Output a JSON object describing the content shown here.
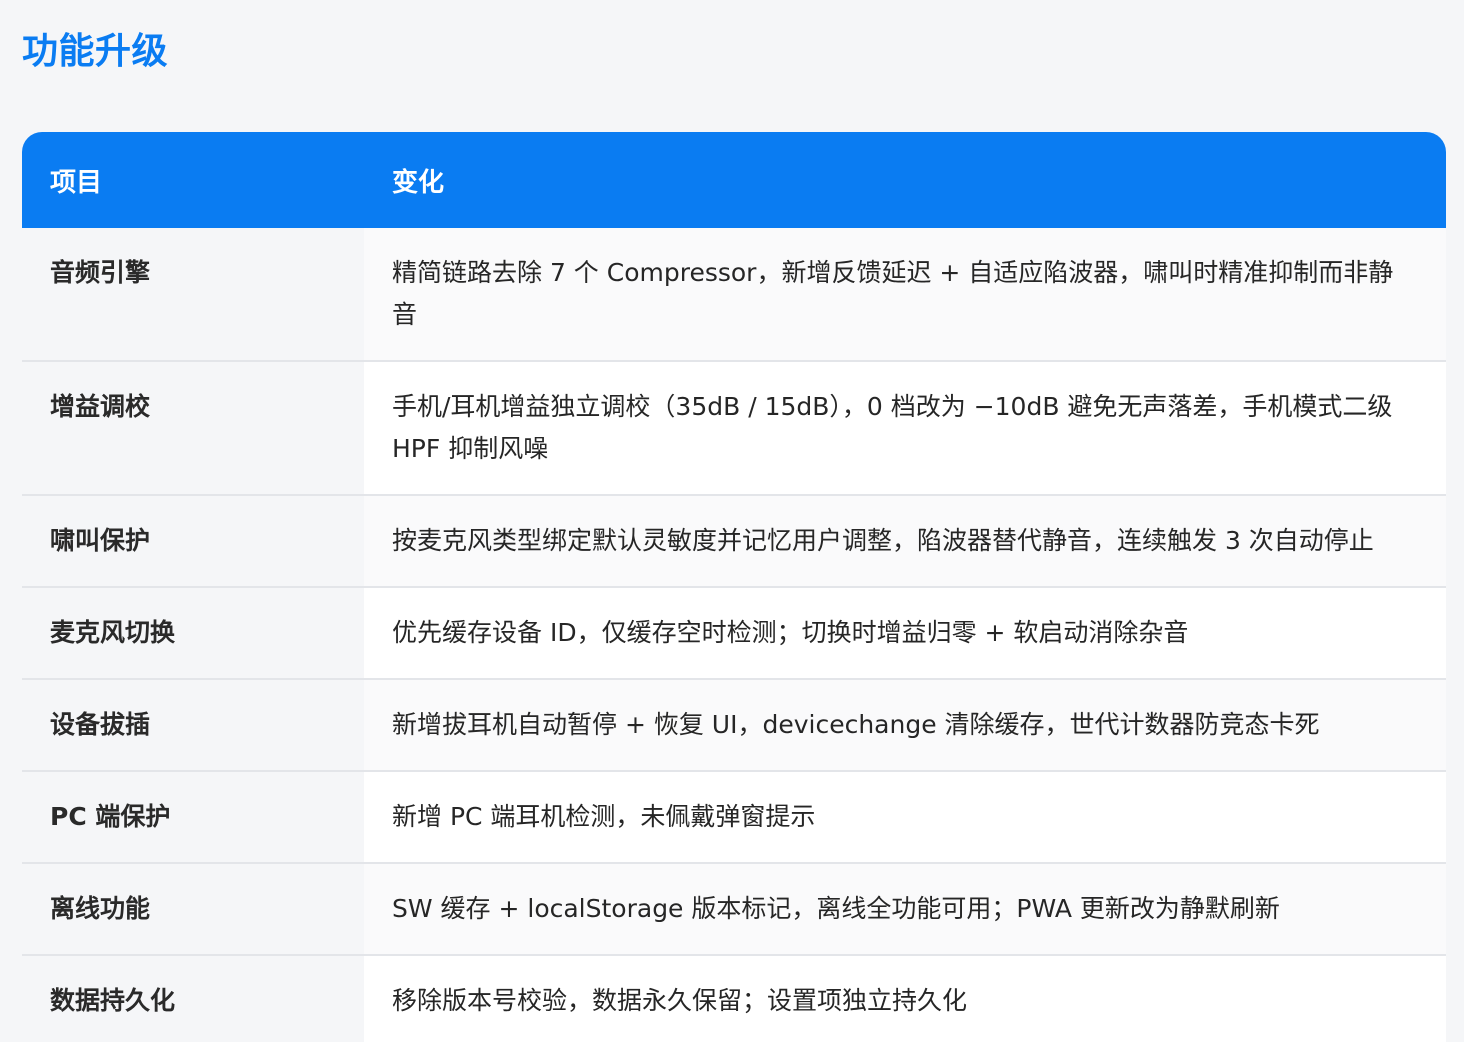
{
  "title": "功能升级",
  "table": {
    "headers": [
      "项目",
      "变化"
    ],
    "rows": [
      {
        "item": "音频引擎",
        "change": "精简链路去除 7 个 Compressor，新增反馈延迟 + 自适应陷波器，啸叫时精准抑制而非静音"
      },
      {
        "item": "增益调校",
        "change": "手机/耳机增益独立调校（35dB / 15dB），0 档改为 −10dB 避免无声落差，手机模式二级 HPF 抑制风噪"
      },
      {
        "item": "啸叫保护",
        "change": "按麦克风类型绑定默认灵敏度并记忆用户调整，陷波器替代静音，连续触发 3 次自动停止"
      },
      {
        "item": "麦克风切换",
        "change": "优先缓存设备 ID，仅缓存空时检测；切换时增益归零 + 软启动消除杂音"
      },
      {
        "item": "设备拔插",
        "change": "新增拔耳机自动暂停 + 恢复 UI，devicechange 清除缓存，世代计数器防竞态卡死"
      },
      {
        "item": "PC 端保护",
        "change": "新增 PC 端耳机检测，未佩戴弹窗提示"
      },
      {
        "item": "离线功能",
        "change": "SW 缓存 + localStorage 版本标记，离线全功能可用；PWA 更新改为静默刷新"
      },
      {
        "item": "数据持久化",
        "change": "移除版本号校验，数据永久保留；设置项独立持久化"
      }
    ]
  }
}
